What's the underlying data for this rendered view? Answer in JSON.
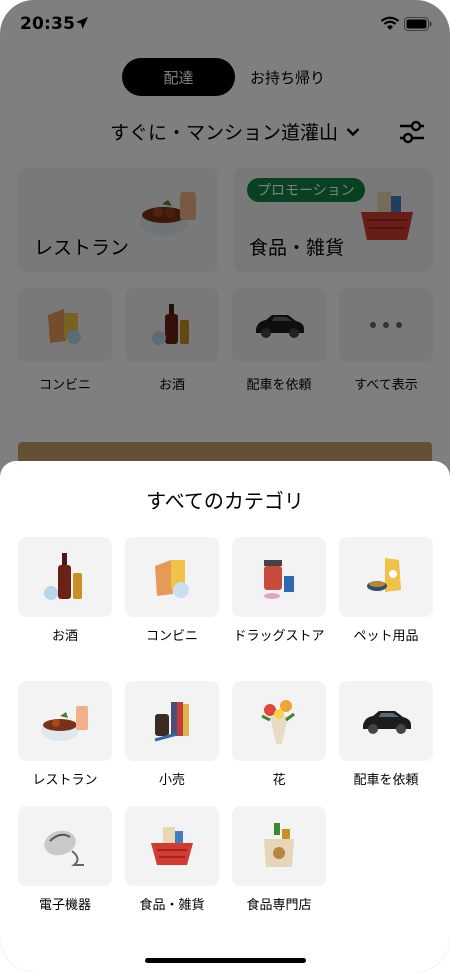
{
  "status_bar": {
    "time": "20:35"
  },
  "mode_toggle": {
    "delivery": "配達",
    "pickup": "お持ち帰り"
  },
  "address": {
    "label": "すぐに・マンション道灌山"
  },
  "tiles": {
    "restaurant": "レストラン",
    "grocery": "食品・雑貨",
    "promo_badge": "プロモーション"
  },
  "shortcuts": [
    {
      "label": "コンビニ"
    },
    {
      "label": "お酒"
    },
    {
      "label": "配車を依頼"
    },
    {
      "label": "すべて表示"
    }
  ],
  "sheet": {
    "title": "すべてのカテゴリ",
    "categories": [
      {
        "label": "お酒",
        "icon": "liquor-icon"
      },
      {
        "label": "コンビニ",
        "icon": "convenience-store-icon"
      },
      {
        "label": "ドラッグストア",
        "icon": "drugstore-icon"
      },
      {
        "label": "ペット用品",
        "icon": "pet-supplies-icon"
      },
      {
        "label": "レストラン",
        "icon": "restaurant-icon"
      },
      {
        "label": "小売",
        "icon": "retail-icon"
      },
      {
        "label": "花",
        "icon": "flowers-icon"
      },
      {
        "label": "配車を依頼",
        "icon": "car-icon"
      },
      {
        "label": "電子機器",
        "icon": "electronics-icon"
      },
      {
        "label": "食品・雑貨",
        "icon": "grocery-icon"
      },
      {
        "label": "食品専門店",
        "icon": "specialty-food-icon"
      }
    ]
  },
  "colors": {
    "promo_green": "#0e8345",
    "sheet_tile": "#f3f3f3",
    "overlay": "rgba(0,0,0,0.5)"
  }
}
